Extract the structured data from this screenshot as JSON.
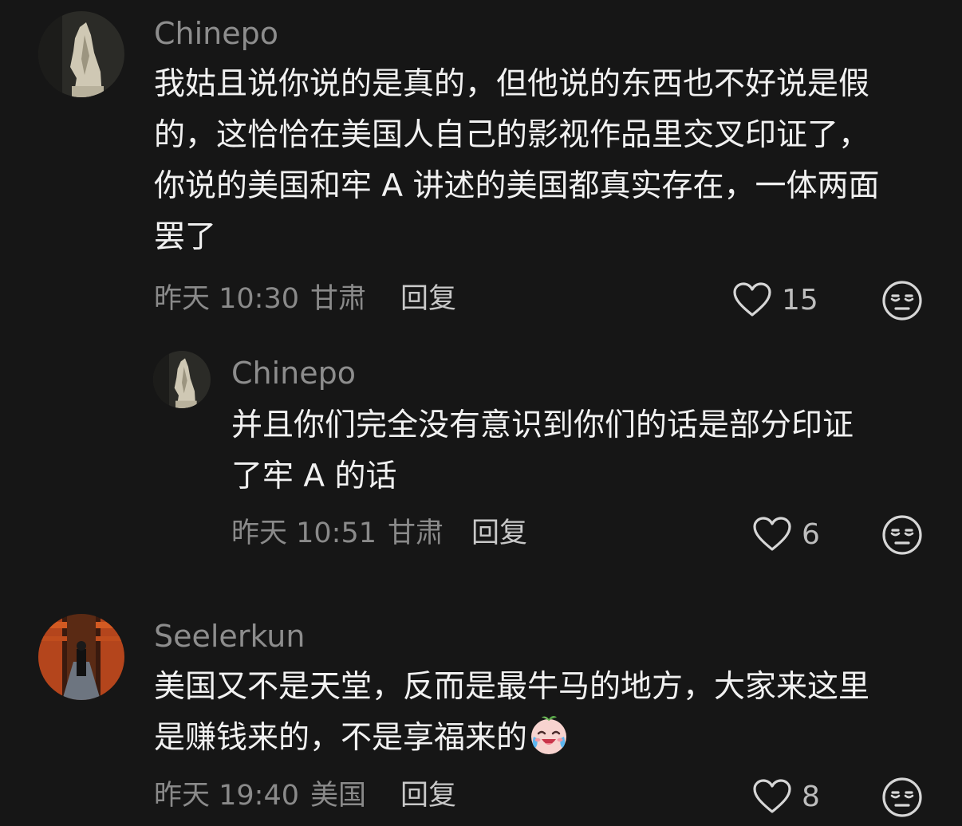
{
  "comments": [
    {
      "username": "Chinepo",
      "avatar_icon": "horse-statue-avatar",
      "lines": [
        "我姑且说你说的是真的，但他说的东西也不好说是假",
        "的，这恰恰在美国人自己的影视作品里交叉印证了，",
        "你说的美国和牢 A 讲述的美国都真实存在，一体两面",
        "罢了"
      ],
      "time": "昨天 10:30",
      "location": "甘肃",
      "reply_label": "回复",
      "likes": "15"
    },
    {
      "username": "Chinepo",
      "avatar_icon": "horse-statue-avatar",
      "lines": [
        "并且你们完全没有意识到你们的话是部分印证",
        "了牢 A 的话"
      ],
      "time": "昨天 10:51",
      "location": "甘肃",
      "reply_label": "回复",
      "likes": "6"
    },
    {
      "username": "Seelerkun",
      "avatar_icon": "torii-corridor-avatar",
      "lines": [
        "美国又不是天堂，反而是最牛马的地方，大家来这里",
        "是赚钱来的，不是享福来的"
      ],
      "emoji": "crying-laughing-face-emoji",
      "time": "昨天 19:40",
      "location": "美国",
      "reply_label": "回复",
      "likes": "8"
    }
  ],
  "icons": {
    "like": "heart-outline-icon",
    "dislike": "unamused-face-icon"
  },
  "colors": {
    "background": "#161616",
    "text": "#f1f1f1",
    "muted": "#8a8a8a"
  }
}
